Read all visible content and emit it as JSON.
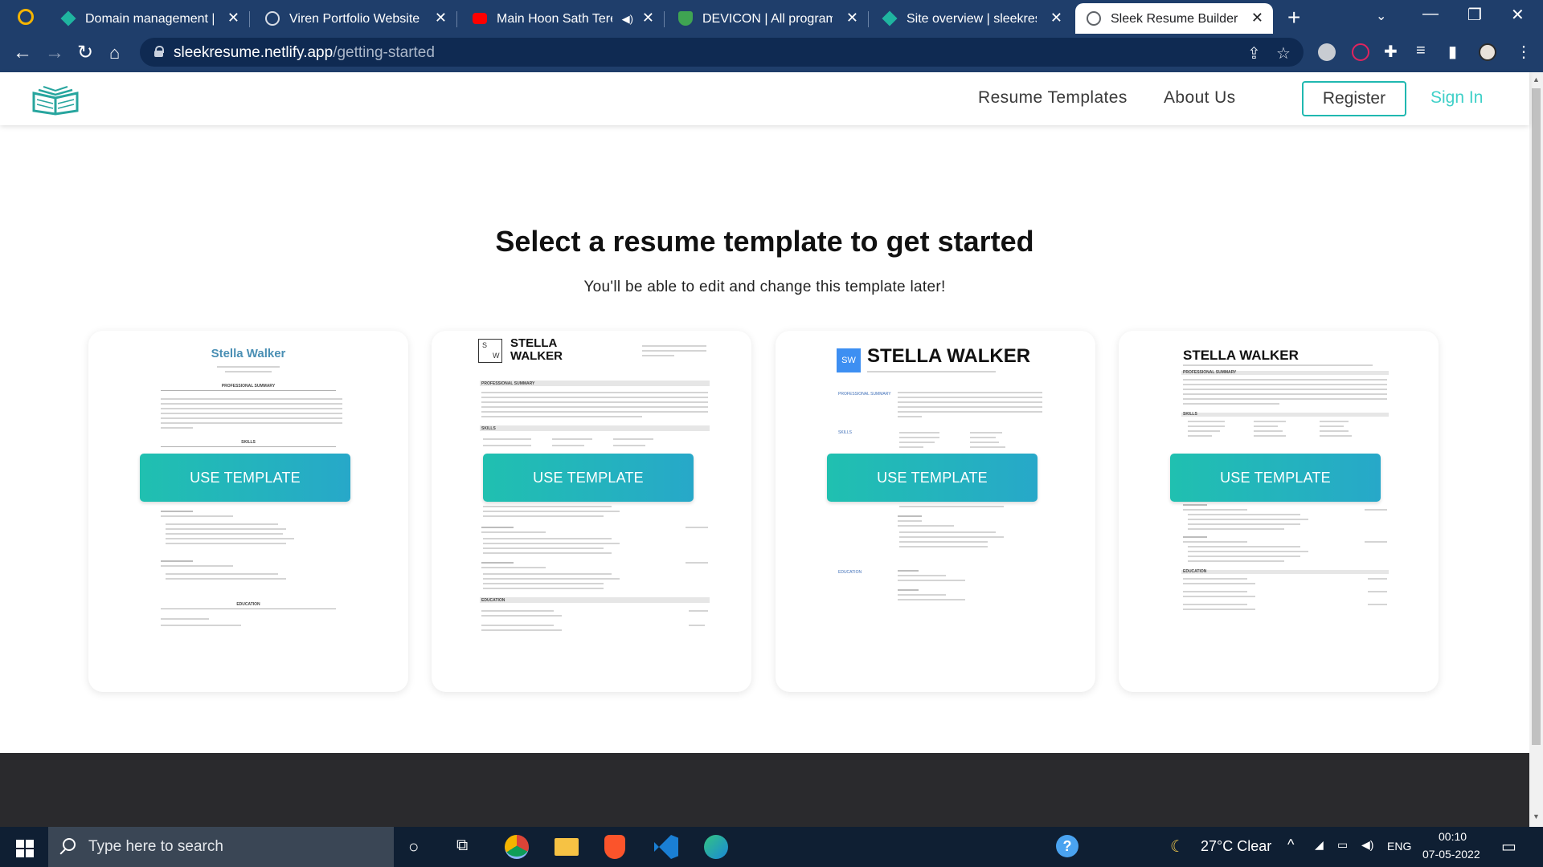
{
  "browser": {
    "tabs": [
      {
        "title": "Domain management | Sit",
        "favicon": "netlify-diamond-icon"
      },
      {
        "title": "Viren Portfolio Website",
        "favicon": "globe-icon"
      },
      {
        "title": "Main Hoon Sath Tere",
        "favicon": "youtube-icon"
      },
      {
        "title": "DEVICON | All programmin",
        "favicon": "shield-icon"
      },
      {
        "title": "Site overview | sleekresum",
        "favicon": "netlify-diamond-icon"
      },
      {
        "title": "Sleek Resume Builder",
        "favicon": "globe-icon"
      }
    ],
    "active_tab": 5,
    "url_host": "sleekresume.netlify.app",
    "url_path": "/getting-started"
  },
  "site": {
    "nav": {
      "templates": "Resume Templates",
      "about": "About Us",
      "register": "Register",
      "signin": "Sign In"
    },
    "title": "Select a resume template to get started",
    "subtitle": "You'll be able to edit and change this template later!",
    "use_template": "USE TEMPLATE",
    "templates": [
      {
        "name": "Stella Walker",
        "sections": [
          "PROFESSIONAL SUMMARY",
          "SKILLS",
          "EDUCATION"
        ]
      },
      {
        "name_line1": "STELLA",
        "name_line2": "WALKER",
        "initial_s": "S",
        "initial_w": "W",
        "sections": [
          "PROFESSIONAL SUMMARY",
          "SKILLS",
          "EDUCATION"
        ]
      },
      {
        "badge": "SW",
        "name": "STELLA WALKER",
        "sections": [
          "PROFESSIONAL SUMMARY",
          "SKILLS",
          "EDUCATION"
        ]
      },
      {
        "name": "STELLA WALKER",
        "sections": [
          "PROFESSIONAL SUMMARY",
          "SKILLS",
          "EDUCATION"
        ]
      }
    ]
  },
  "taskbar": {
    "search_placeholder": "Type here to search",
    "weather": "27°C  Clear",
    "language": "ENG",
    "time": "00:10",
    "date": "07-05-2022"
  },
  "colors": {
    "accent": "#1fb8b0",
    "browser_chrome": "#1f3e6b",
    "button_gradient_start": "#20c0b0",
    "button_gradient_end": "#27a8c9"
  }
}
